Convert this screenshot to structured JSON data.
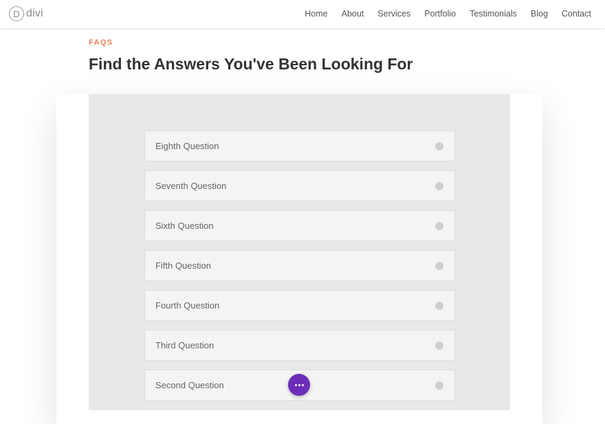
{
  "header": {
    "logo_letter": "D",
    "logo_text": "divi",
    "nav": [
      "Home",
      "About",
      "Services",
      "Portfolio",
      "Testimonials",
      "Blog",
      "Contact"
    ]
  },
  "section": {
    "eyebrow": "FAQS",
    "title": "Find the Answers You've Been Looking For"
  },
  "faq": {
    "items": [
      "Eighth Question",
      "Seventh Question",
      "Sixth Question",
      "Fifth Question",
      "Fourth Question",
      "Third Question",
      "Second Question"
    ]
  },
  "colors": {
    "accent": "#e77c55",
    "fab": "#6c2eb9"
  },
  "icons": {
    "toggle": "circle-toggle-icon",
    "fab": "more-dots-icon"
  }
}
